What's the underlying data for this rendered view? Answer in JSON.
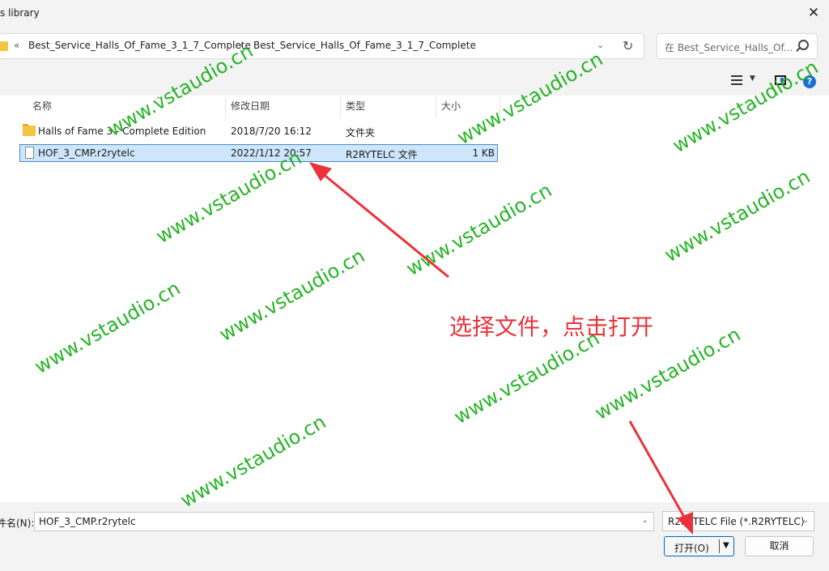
{
  "window": {
    "title": "s library",
    "close_glyph": "✕"
  },
  "address": {
    "back_glyph": "«",
    "crumbs": [
      "Best_Service_Halls_Of_Fame_3_1_7_Complete",
      "Best_Service_Halls_Of_Fame_3_1_7_Complete"
    ],
    "separator": "›",
    "dropdown_glyph": "⌄",
    "refresh_glyph": "↻"
  },
  "search": {
    "placeholder": "在 Best_Service_Halls_Of..."
  },
  "toolbar": {
    "view_icon": "list-view-icon",
    "preview_icon": "preview-pane-icon",
    "help_glyph": "?"
  },
  "columns": [
    "名称",
    "修改日期",
    "类型",
    "大小"
  ],
  "files": [
    {
      "name": "Halls of Fame 3 - Complete Edition",
      "date": "2018/7/20 16:12",
      "type": "文件夹",
      "size": "",
      "icon": "folder-icon",
      "selected": false
    },
    {
      "name": "HOF_3_CMP.r2rytelc",
      "date": "2022/1/12 20:57",
      "type": "R2RYTELC 文件",
      "size": "1 KB",
      "icon": "file-icon",
      "selected": true
    }
  ],
  "filename": {
    "label": "件名(N):",
    "value": "HOF_3_CMP.r2rytelc"
  },
  "filetype": {
    "value": "R2RYTELC File (*.R2RYTELC)"
  },
  "buttons": {
    "open": "打开(O)",
    "cancel": "取消"
  },
  "annotation": "选择文件，点击打开",
  "watermark": "www.vstaudio.cn",
  "colors": {
    "accent": "#0067c0",
    "selection": "#cde6fb",
    "annotation": "#e8333a",
    "watermark": "#1db01d"
  }
}
